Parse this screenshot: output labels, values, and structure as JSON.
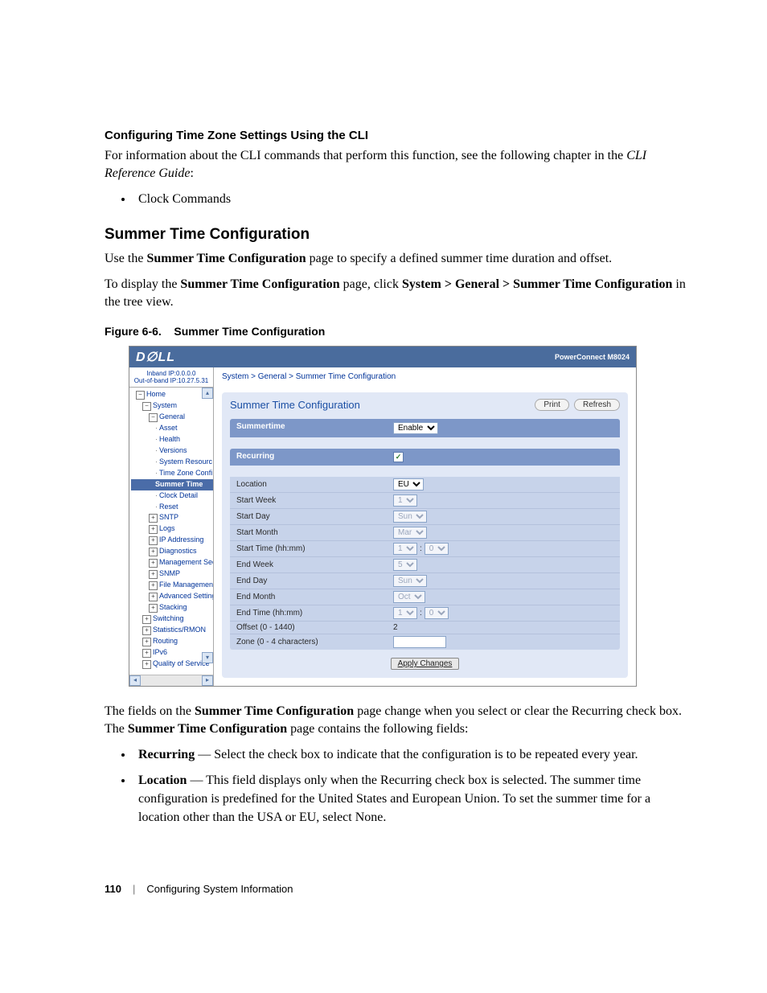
{
  "doc": {
    "tz_cli_heading": "Configuring Time Zone Settings Using the CLI",
    "tz_cli_para_a": "For information about the CLI commands that perform this function, see the following chapter in the ",
    "tz_cli_para_b": "CLI Reference Guide",
    "tz_cli_para_c": ":",
    "tz_cli_bullet": "Clock Commands",
    "summer_heading": "Summer Time Configuration",
    "summer_p1_a": "Use the ",
    "summer_p1_b": "Summer Time Configuration",
    "summer_p1_c": " page to specify a defined summer time duration and offset.",
    "summer_p2_a": "To display the ",
    "summer_p2_b": "Summer Time Configuration",
    "summer_p2_c": " page, click ",
    "summer_p2_d": "System > General > Summer Time Configuration",
    "summer_p2_e": " in the tree view.",
    "fig_caption_a": "Figure 6-6.",
    "fig_caption_b": "Summer Time Configuration",
    "post_p1_a": "The fields on the ",
    "post_p1_b": "Summer Time Configuration",
    "post_p1_c": " page change when you select or clear the Recurring check box. The ",
    "post_p1_d": "Summer Time Configuration",
    "post_p1_e": " page contains the following fields:",
    "bullet2_a_bold": "Recurring",
    "bullet2_a_rest": " — Select the check box to indicate that the configuration is to be repeated every year.",
    "bullet2_b_bold": "Location",
    "bullet2_b_rest": " — This field displays only when the Recurring check box is selected. The summer time configuration is predefined for the United States and European Union. To set the summer time for a location other than the USA or EU, select None."
  },
  "footer": {
    "page": "110",
    "chapter": "Configuring System Information"
  },
  "shot": {
    "model": "PowerConnect M8024",
    "logo": "D∅LL",
    "ip1": "Inband IP:0.0.0.0",
    "ip2": "Out-of-band IP:10.27.5.31",
    "crumb": "System > General > Summer Time Configuration",
    "panel_title": "Summer Time Configuration",
    "btn_print": "Print",
    "btn_refresh": "Refresh",
    "hdr_summertime": "Summertime",
    "summertime_val": "Enable",
    "hdr_recurring": "Recurring",
    "recurring_checked": "✓",
    "rows": {
      "location": {
        "label": "Location",
        "val": "EU"
      },
      "start_week": {
        "label": "Start Week",
        "val": "1"
      },
      "start_day": {
        "label": "Start Day",
        "val": "Sun"
      },
      "start_month": {
        "label": "Start Month",
        "val": "Mar"
      },
      "start_time": {
        "label": "Start Time (hh:mm)",
        "hh": "1",
        "mm": "0"
      },
      "end_week": {
        "label": "End Week",
        "val": "5"
      },
      "end_day": {
        "label": "End Day",
        "val": "Sun"
      },
      "end_month": {
        "label": "End Month",
        "val": "Oct"
      },
      "end_time": {
        "label": "End Time (hh:mm)",
        "hh": "1",
        "mm": "0"
      },
      "offset": {
        "label": "Offset (0 - 1440)",
        "val": "2"
      },
      "zone": {
        "label": "Zone (0 - 4 characters)",
        "val": ""
      }
    },
    "apply": "Apply Changes",
    "tree": {
      "home": "Home",
      "system": "System",
      "general": "General",
      "asset": "Asset",
      "health": "Health",
      "versions": "Versions",
      "sysres": "System Resourc",
      "tzconf": "Time Zone Confi",
      "summer": "Summer Time",
      "clockdet": "Clock Detail",
      "reset": "Reset",
      "sntp": "SNTP",
      "logs": "Logs",
      "ipaddr": "IP Addressing",
      "diag": "Diagnostics",
      "mgmtsec": "Management Secur",
      "snmp": "SNMP",
      "filemg": "File Management",
      "adv": "Advanced Settings",
      "stack": "Stacking",
      "switch": "Switching",
      "stats": "Statistics/RMON",
      "routing": "Routing",
      "ipv6": "IPv6",
      "qos": "Quality of Service"
    }
  }
}
